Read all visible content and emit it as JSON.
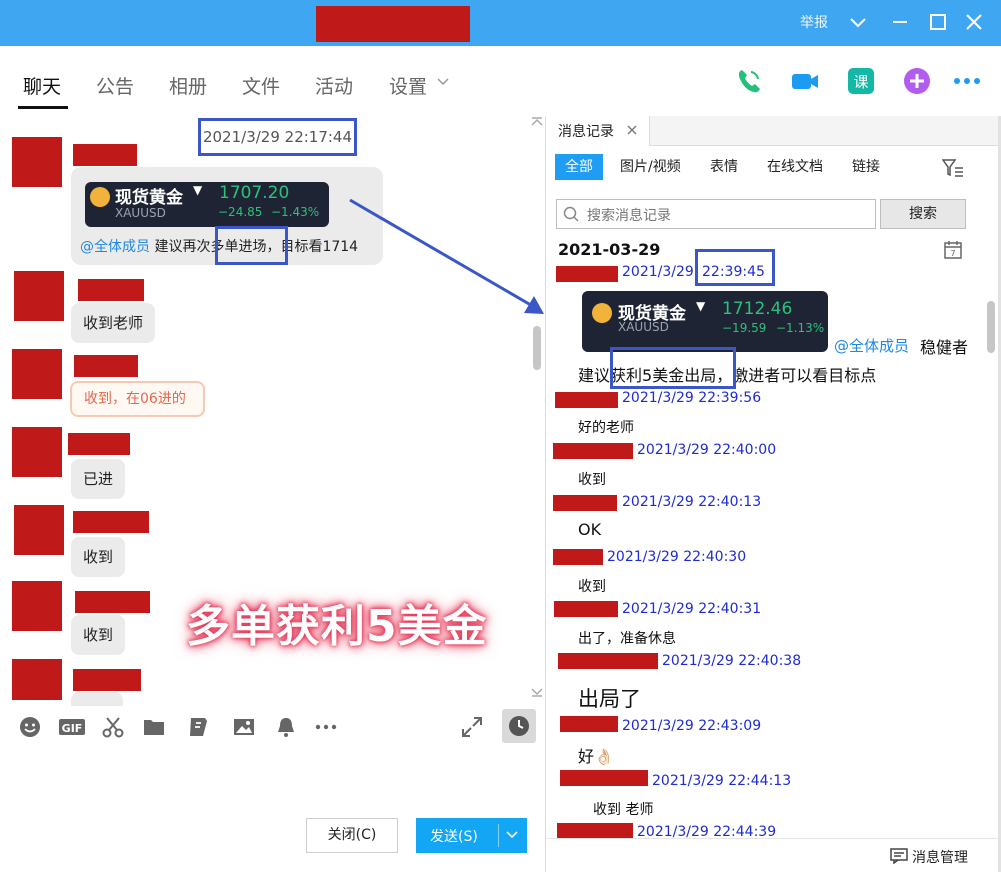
{
  "titlebar": {
    "report_label": "举报"
  },
  "tabs": [
    "聊天",
    "公告",
    "相册",
    "文件",
    "活动",
    "设置"
  ],
  "chat": {
    "timestamp": "2021/3/29 22:17:44",
    "card": {
      "name": "现货黄金",
      "symbol": "XAUUSD",
      "price": "1707.20",
      "change": "−24.85",
      "change_pct": "−1.43%"
    },
    "first_msg": {
      "mention": "@全体成员",
      "text": " 建议再次多单进场，目标看1714"
    },
    "messages": [
      "收到老师",
      "收到，在06进的",
      "已进",
      "收到",
      "收到"
    ],
    "overlay": "多单获利5美金"
  },
  "buttons": {
    "close": "关闭(C)",
    "send": "发送(S)"
  },
  "history": {
    "tab_label": "消息记录",
    "filters": [
      "全部",
      "图片/视频",
      "表情",
      "在线文档",
      "链接"
    ],
    "search_placeholder": "搜索消息记录",
    "search_button": "搜索",
    "date": "2021-03-29",
    "card": {
      "name": "现货黄金",
      "symbol": "XAUUSD",
      "price": "1712.46",
      "change": "−19.59",
      "change_pct": "−1.13%"
    },
    "first_time_prefix": "2021/3/29 ",
    "first_time_highlight": "22:39:45",
    "first_mention": "@全体成员",
    "first_tail": "稳健者",
    "first_line2_pre": "建议",
    "first_line2_box": "获利5美金出局，",
    "first_line2_post": "激进者可以看目标点",
    "entries": [
      {
        "time": "2021/3/29 22:39:56",
        "msg": "好的老师"
      },
      {
        "time": "2021/3/29 22:40:00",
        "msg": "收到"
      },
      {
        "time": "2021/3/29 22:40:13",
        "msg": "OK"
      },
      {
        "time": "2021/3/29 22:40:30",
        "msg": "收到"
      },
      {
        "time": "2021/3/29 22:40:31",
        "msg": "出了，准备休息"
      },
      {
        "time": "2021/3/29 22:40:38",
        "msg": "出局了"
      },
      {
        "time": "2021/3/29 22:43:09",
        "msg": "好👌🏻"
      },
      {
        "time": "2021/3/29 22:44:13",
        "msg": "收到 老师"
      },
      {
        "time": "2021/3/29 22:44:39",
        "msg": ""
      }
    ],
    "manage_label": "消息管理"
  },
  "colors": {
    "titlebar": "#3fa7f2",
    "accent": "#1f9df2",
    "redaction": "#c0191a",
    "highlight_box": "#3b57c7",
    "time_blue": "#1f2bd4"
  }
}
